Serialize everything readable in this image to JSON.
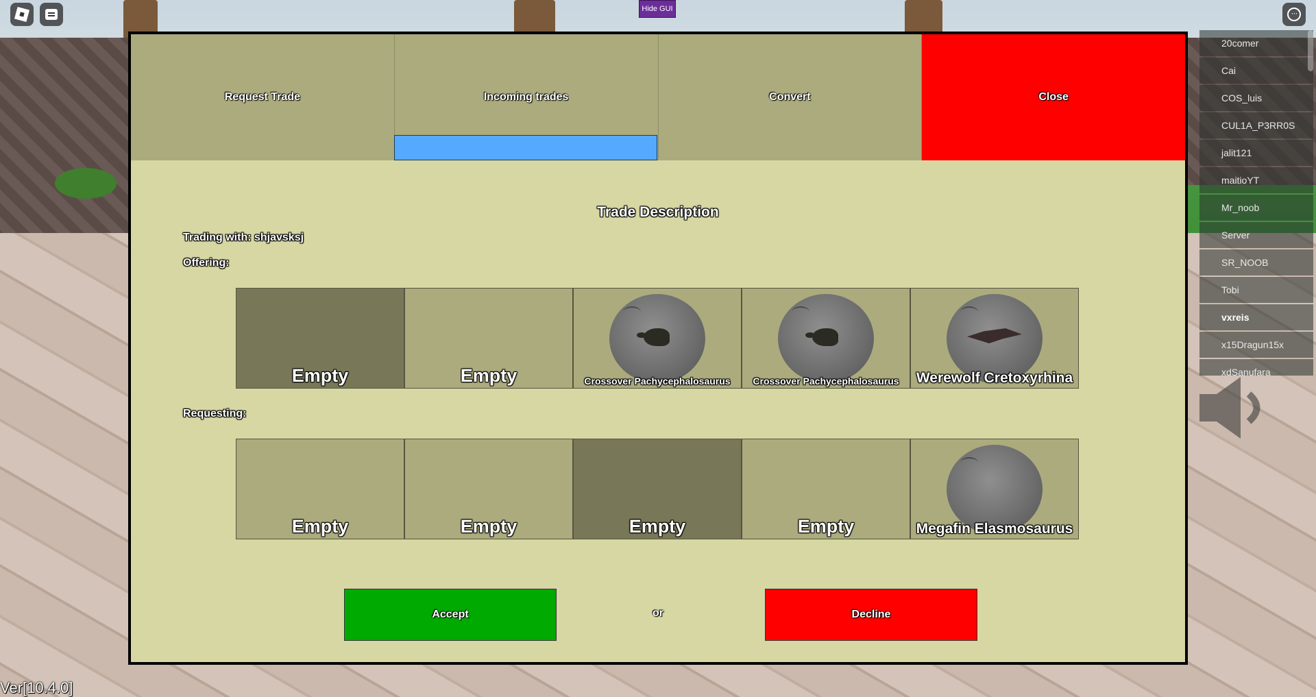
{
  "hud": {
    "hide_gui_label": "Hide GUI",
    "version": "Ver[10.4.0]",
    "roblox_menu_icon": "roblox-logo-icon",
    "chat_icon": "chat-icon",
    "more_icon": "more-options-icon"
  },
  "players": [
    {
      "name": "20comer"
    },
    {
      "name": "Cai"
    },
    {
      "name": "COS_luis"
    },
    {
      "name": "CUL1A_P3RR0S"
    },
    {
      "name": "jalit121"
    },
    {
      "name": "maitioYT"
    },
    {
      "name": "Mr_noob"
    },
    {
      "name": "Server"
    },
    {
      "name": "SR_NOOB"
    },
    {
      "name": "Tobi"
    },
    {
      "name": "vxreis"
    },
    {
      "name": "x15Dragun15x"
    },
    {
      "name": "xdSanufara"
    }
  ],
  "trade": {
    "tabs": {
      "request": "Request Trade",
      "incoming": "Incoming trades",
      "convert": "Convert",
      "close": "Close"
    },
    "active_tab": "incoming",
    "description_title": "Trade Description",
    "trading_with": "Trading with: shjavsksj",
    "offering_label": "Offering:",
    "requesting_label": "Requesting:",
    "offering": [
      {
        "name": "Empty"
      },
      {
        "name": "Empty"
      },
      {
        "name": "Crossover Pachycephalosaurus"
      },
      {
        "name": "Crossover Pachycephalosaurus"
      },
      {
        "name": "Werewolf Cretoxyrhina"
      }
    ],
    "requesting": [
      {
        "name": "Empty"
      },
      {
        "name": "Empty"
      },
      {
        "name": "Empty"
      },
      {
        "name": "Empty"
      },
      {
        "name": "Megafin Elasmosaurus"
      }
    ],
    "accept_label": "Accept",
    "or_label": "or",
    "decline_label": "Decline",
    "colors": {
      "panel": "#d6d7a2",
      "tab": "#abab7d",
      "slot": "#abab7d",
      "slot_selected": "#787858",
      "close": "#ff0000",
      "accept": "#00aa00",
      "decline": "#ff0000",
      "tab_indicator": "#55aaff"
    }
  }
}
